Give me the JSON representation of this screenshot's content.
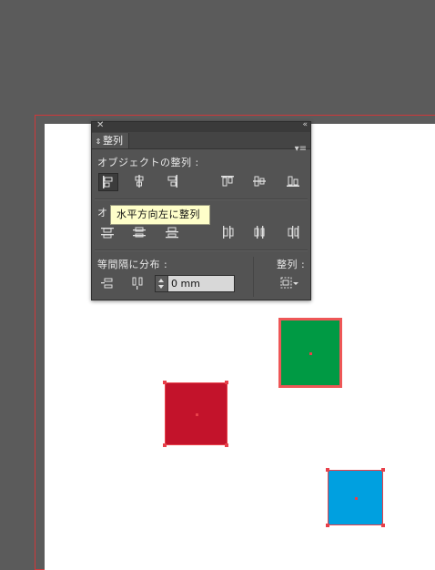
{
  "panel": {
    "close_icon": "✕",
    "collapse_icon": "«",
    "tab_label": "整列",
    "menu_icon": "▾≡",
    "section_align_objects": "オブジェクトの整列 :",
    "section_distribute_objects_prefix": "オ",
    "section_distribute_spacing": "等間隔に分布 :",
    "section_align_to": "整列 :",
    "spacing_value": "0 mm"
  },
  "tooltip": {
    "text": "水平方向左に整列"
  },
  "colors": {
    "panel_bg": "#535353",
    "artboard_bg": "#ffffff",
    "canvas_bg": "#5b5b5b",
    "bleed_line": "#d0383a",
    "green_square": "#009a44",
    "red_square": "#c3132b",
    "blue_square": "#00a0e0",
    "key_object_outline": "#ee5757",
    "selection_handle": "#e8404a",
    "tooltip_bg": "#fefec9"
  },
  "icons": {
    "align_row": [
      "align-left-icon",
      "align-horizontal-center-icon",
      "align-right-icon",
      "align-top-icon",
      "align-vertical-center-icon",
      "align-bottom-icon"
    ],
    "distribute_row": [
      "distribute-top-icon",
      "distribute-vertical-center-icon",
      "distribute-bottom-icon",
      "distribute-left-icon",
      "distribute-horizontal-center-icon",
      "distribute-right-icon"
    ],
    "spacing_row": [
      "distribute-vertical-space-icon",
      "distribute-horizontal-space-icon"
    ],
    "align_to": "align-to-selection-icon"
  }
}
